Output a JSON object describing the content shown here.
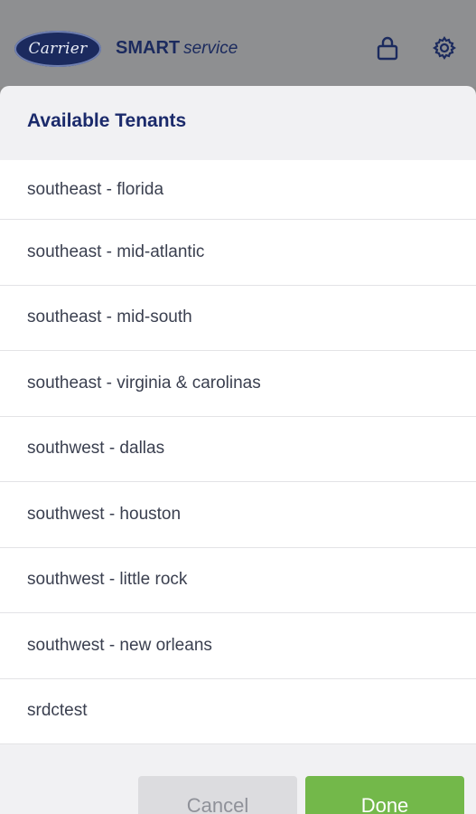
{
  "header": {
    "logo_text": "Carrier",
    "brand_bold": "SMART",
    "brand_italic": "service",
    "icons": [
      "lock-icon",
      "gear-icon"
    ],
    "brand_color": "#1b2a5e"
  },
  "sheet": {
    "title": "Available Tenants",
    "tenants": [
      "southeast - florida",
      "southeast - mid-atlantic",
      "southeast - mid-south",
      "southeast - virginia & carolinas",
      "southwest - dallas",
      "southwest - houston",
      "southwest - little rock",
      "southwest - new orleans",
      "srdctest"
    ]
  },
  "footer": {
    "cancel_label": "Cancel",
    "done_label": "Done",
    "done_color": "#73b84a"
  }
}
